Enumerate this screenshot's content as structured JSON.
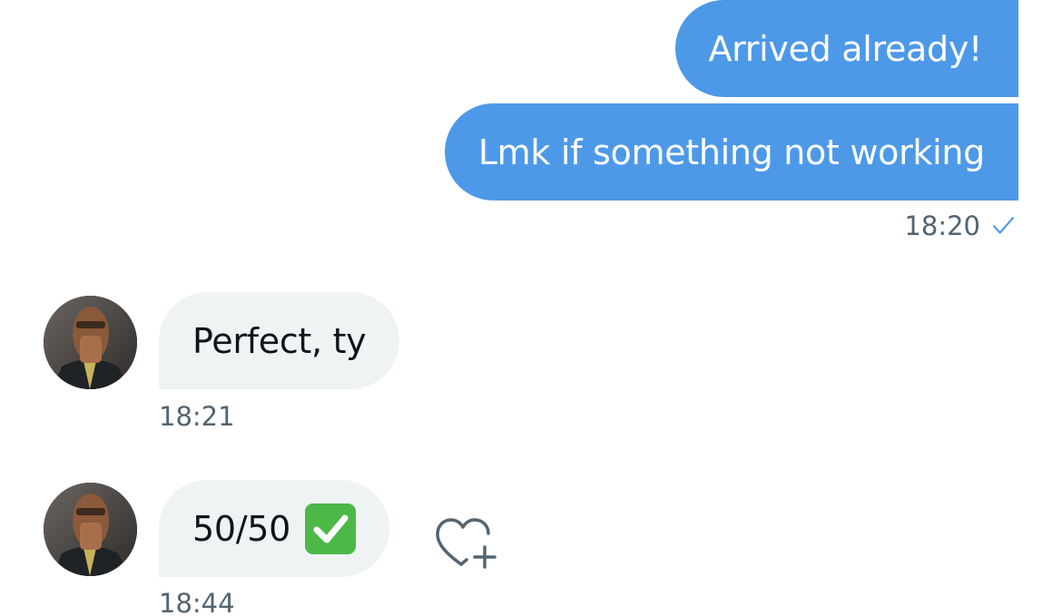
{
  "messages": {
    "outgoing": [
      {
        "text": "Arrived already!"
      },
      {
        "text": "Lmk if something not working"
      }
    ],
    "outgoing_meta": {
      "time": "18:20",
      "status_icon": "sent-check-icon"
    },
    "incoming": [
      {
        "text": "Perfect, ty",
        "time": "18:21"
      },
      {
        "text": "50/50",
        "emoji": "check-mark-button-emoji",
        "time": "18:44"
      }
    ]
  },
  "colors": {
    "outgoing_bubble": "#4d99e8",
    "incoming_bubble": "#eff3f4",
    "timestamp": "#536471",
    "emoji_green": "#4cb848"
  },
  "icons": {
    "reaction": "heart-plus-icon",
    "avatar": "user-avatar"
  }
}
